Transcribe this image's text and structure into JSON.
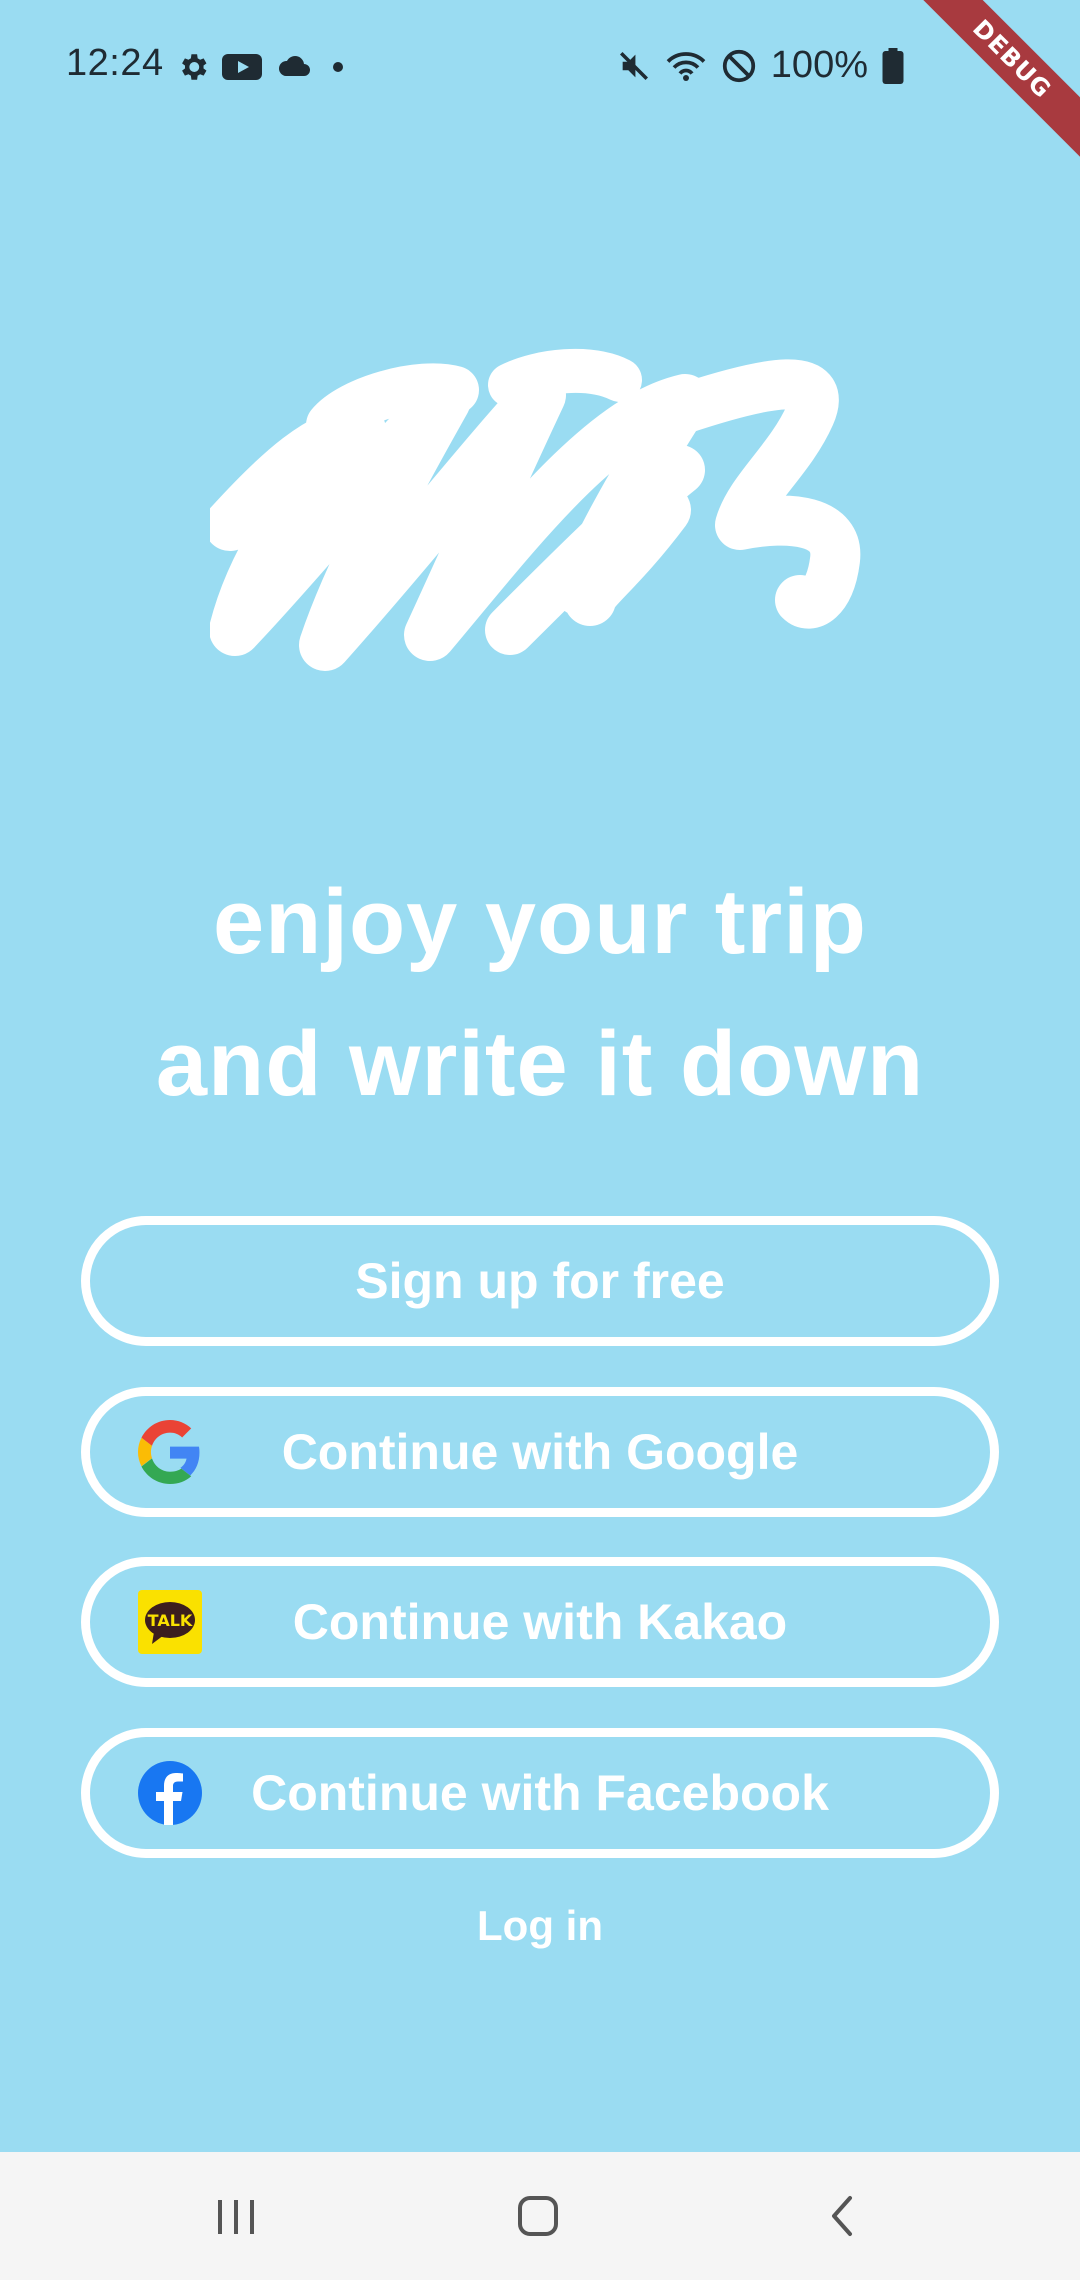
{
  "status_bar": {
    "time": "12:24",
    "battery_text": "100%",
    "left_icons": [
      "settings-icon",
      "youtube-icon",
      "cloud-icon",
      "dot-icon"
    ],
    "right_icons": [
      "mute-icon",
      "wifi-icon",
      "do-not-disturb-icon",
      "battery-icon"
    ]
  },
  "debug_banner": {
    "label": "DEBUG",
    "color": "#a83a3f"
  },
  "tagline": {
    "line1": "enjoy your trip",
    "line2": "and write it down"
  },
  "buttons": {
    "signup": {
      "label": "Sign up for free"
    },
    "google": {
      "label": "Continue with Google",
      "icon": "google-icon"
    },
    "kakao": {
      "label": "Continue with Kakao",
      "icon": "kakao-talk-icon",
      "icon_text": "TALK"
    },
    "facebook": {
      "label": "Continue with Facebook",
      "icon": "facebook-icon"
    }
  },
  "login": {
    "label": "Log in"
  },
  "nav_bar": {
    "items": [
      "recents-icon",
      "home-icon",
      "back-icon"
    ]
  },
  "colors": {
    "background": "#9adcf2",
    "foreground": "#ffffff",
    "nav_background": "#f5f5f5"
  }
}
